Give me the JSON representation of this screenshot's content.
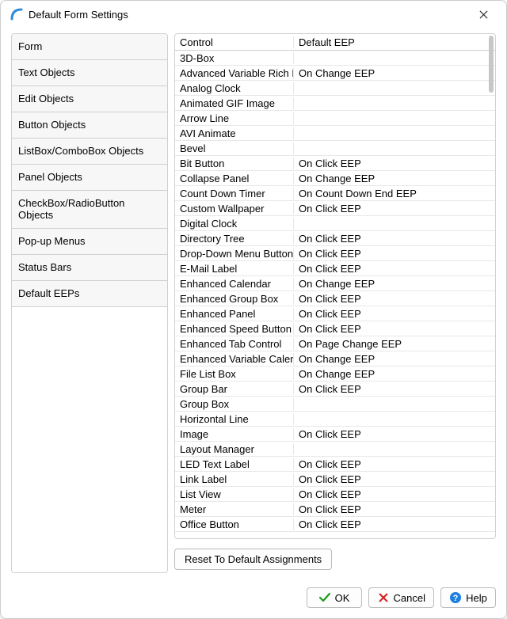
{
  "window": {
    "title": "Default Form Settings"
  },
  "sidebar": {
    "items": [
      {
        "label": "Form"
      },
      {
        "label": "Text Objects"
      },
      {
        "label": "Edit Objects"
      },
      {
        "label": "Button Objects"
      },
      {
        "label": "ListBox/ComboBox Objects"
      },
      {
        "label": "Panel Objects"
      },
      {
        "label": "CheckBox/RadioButton Objects"
      },
      {
        "label": "Pop-up Menus"
      },
      {
        "label": "Status Bars"
      },
      {
        "label": "Default EEPs"
      }
    ]
  },
  "grid": {
    "header": {
      "col1": "Control",
      "col2": "Default EEP"
    },
    "rows": [
      {
        "control": "3D-Box",
        "eep": ""
      },
      {
        "control": "Advanced Variable Rich Edit",
        "eep": "On Change EEP"
      },
      {
        "control": "Analog Clock",
        "eep": ""
      },
      {
        "control": "Animated GIF Image",
        "eep": ""
      },
      {
        "control": "Arrow Line",
        "eep": ""
      },
      {
        "control": "AVI Animate",
        "eep": ""
      },
      {
        "control": "Bevel",
        "eep": ""
      },
      {
        "control": "Bit Button",
        "eep": "On Click EEP"
      },
      {
        "control": "Collapse Panel",
        "eep": "On Change EEP"
      },
      {
        "control": "Count Down Timer",
        "eep": "On Count Down End EEP"
      },
      {
        "control": "Custom Wallpaper",
        "eep": "On Click EEP"
      },
      {
        "control": "Digital Clock",
        "eep": ""
      },
      {
        "control": "Directory Tree",
        "eep": "On Click EEP"
      },
      {
        "control": "Drop-Down Menu Button",
        "eep": "On Click EEP"
      },
      {
        "control": "E-Mail Label",
        "eep": "On Click EEP"
      },
      {
        "control": "Enhanced Calendar",
        "eep": "On Change EEP"
      },
      {
        "control": "Enhanced Group Box",
        "eep": "On Click EEP"
      },
      {
        "control": "Enhanced Panel",
        "eep": "On Click EEP"
      },
      {
        "control": "Enhanced Speed Button",
        "eep": "On Click EEP"
      },
      {
        "control": "Enhanced Tab Control",
        "eep": "On Page Change EEP"
      },
      {
        "control": "Enhanced Variable Calendar",
        "eep": "On Change EEP"
      },
      {
        "control": "File List Box",
        "eep": "On Change EEP"
      },
      {
        "control": "Group Bar",
        "eep": "On Click EEP"
      },
      {
        "control": "Group Box",
        "eep": ""
      },
      {
        "control": "Horizontal Line",
        "eep": ""
      },
      {
        "control": "Image",
        "eep": "On Click EEP"
      },
      {
        "control": "Layout Manager",
        "eep": ""
      },
      {
        "control": "LED Text Label",
        "eep": "On Click EEP"
      },
      {
        "control": "Link Label",
        "eep": "On Click EEP"
      },
      {
        "control": "List View",
        "eep": "On Click EEP"
      },
      {
        "control": "Meter",
        "eep": "On Click EEP"
      },
      {
        "control": "Office Button",
        "eep": "On Click EEP"
      }
    ]
  },
  "buttons": {
    "reset": "Reset To Default Assignments",
    "ok": "OK",
    "cancel": "Cancel",
    "help": "Help"
  }
}
